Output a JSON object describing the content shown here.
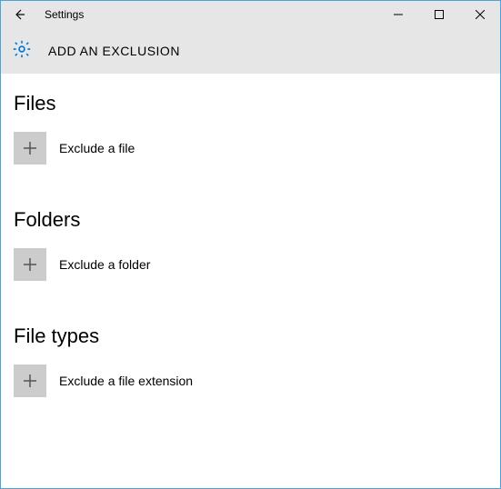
{
  "titlebar": {
    "title": "Settings"
  },
  "header": {
    "title": "ADD AN EXCLUSION"
  },
  "sections": {
    "0": {
      "title": "Files",
      "add_label": "Exclude a file"
    },
    "1": {
      "title": "Folders",
      "add_label": "Exclude a folder"
    },
    "2": {
      "title": "File types",
      "add_label": "Exclude a file extension"
    }
  }
}
